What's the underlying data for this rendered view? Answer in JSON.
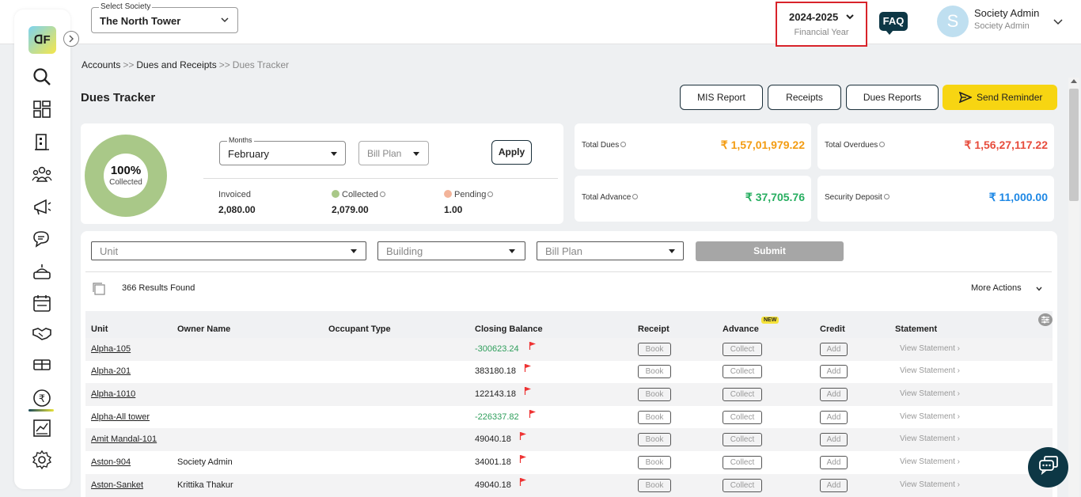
{
  "header": {
    "society_label": "Select Society",
    "society_value": "The North Tower",
    "fy_value": "2024-2025",
    "fy_label": "Financial Year",
    "faq_label": "FAQ",
    "avatar_letter": "S",
    "user_name": "Society Admin",
    "user_role": "Society Admin"
  },
  "sidebar": {
    "logo_text": "ᗡF",
    "items": [
      "search-icon",
      "dashboard-icon",
      "building-icon",
      "members-icon",
      "announcement-icon",
      "chat-icon",
      "service-icon",
      "calendar-icon",
      "handshake-icon",
      "amenities-icon",
      "accounts-rupee-icon",
      "reports-icon",
      "settings-icon"
    ],
    "active_item": "accounts-rupee-icon"
  },
  "breadcrumb": {
    "items": [
      "Accounts",
      "Dues and Receipts"
    ],
    "separator": ">>",
    "current": "Dues Tracker"
  },
  "page": {
    "title": "Dues Tracker",
    "buttons": {
      "mis_report": "MIS Report",
      "receipts": "Receipts",
      "dues_reports": "Dues Reports",
      "send_reminder": "Send Reminder"
    }
  },
  "summary": {
    "collected_pct": "100%",
    "collected_pct_label": "Collected",
    "collected_fraction": 1.0,
    "months_label": "Months",
    "months_value": "February",
    "bill_plan_placeholder": "Bill Plan",
    "apply_label": "Apply",
    "invoiced_label": "Invoiced",
    "invoiced_value": "2,080.00",
    "collected_label": "Collected",
    "collected_value": "2,079.00",
    "pending_label": "Pending",
    "pending_value": "1.00",
    "colors": {
      "collected": "#a9c888",
      "pending": "#f3b49a"
    }
  },
  "totals": {
    "total_dues_label": "Total Dues",
    "total_dues_value": "₹ 1,57,01,979.22",
    "total_overdues_label": "Total Overdues",
    "total_overdues_value": "₹ 1,56,27,117.22",
    "total_advance_label": "Total Advance",
    "total_advance_value": "₹ 37,705.76",
    "security_deposit_label": "Security Deposit",
    "security_deposit_value": "₹ 11,000.00",
    "colors": {
      "dues": "#f39c12",
      "overdues": "#e74c3c",
      "advance": "#27ae60",
      "deposit": "#1e88e5"
    }
  },
  "filters": {
    "unit_placeholder": "Unit",
    "building_placeholder": "Building",
    "bill_plan_placeholder": "Bill Plan",
    "submit_label": "Submit",
    "results_count": "366",
    "results_label": "Results Found",
    "more_actions_label": "More Actions"
  },
  "table": {
    "headers": {
      "unit": "Unit",
      "owner": "Owner Name",
      "occupant": "Occupant Type",
      "closing": "Closing Balance",
      "receipt": "Receipt",
      "advance": "Advance",
      "advance_badge": "NEW",
      "credit": "Credit",
      "statement": "Statement"
    },
    "action_labels": {
      "book": "Book",
      "collect": "Collect",
      "add": "Add",
      "view_statement": "View Statement ›"
    },
    "rows": [
      {
        "unit": "Alpha-105",
        "owner": "",
        "balance": "-300623.24",
        "negative": true
      },
      {
        "unit": "Alpha-201",
        "owner": "",
        "balance": "383180.18",
        "negative": false
      },
      {
        "unit": "Alpha-1010",
        "owner": "",
        "balance": "122143.18",
        "negative": false
      },
      {
        "unit": "Alpha-All tower",
        "owner": "",
        "balance": "-226337.82",
        "negative": true
      },
      {
        "unit": "Amit Mandal-101",
        "owner": "",
        "balance": "49040.18",
        "negative": false
      },
      {
        "unit": "Aston-904",
        "owner": "Society Admin",
        "balance": "34001.18",
        "negative": false
      },
      {
        "unit": "Aston-Sanket",
        "owner": "Krittika Thakur",
        "balance": "49040.18",
        "negative": false
      }
    ]
  }
}
